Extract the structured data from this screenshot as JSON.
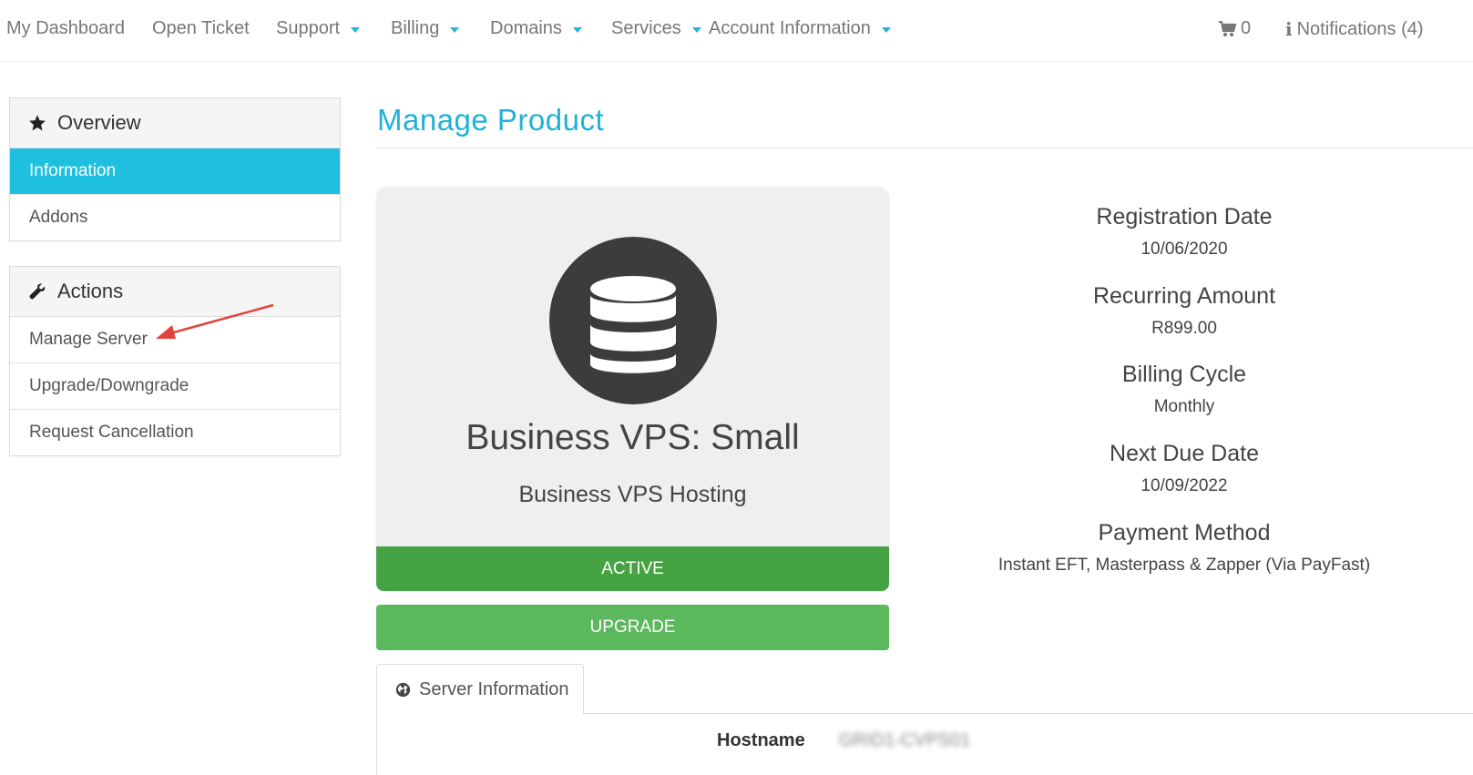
{
  "nav": {
    "items": [
      {
        "label": "My Dashboard",
        "dropdown": false
      },
      {
        "label": "Open Ticket",
        "dropdown": false
      },
      {
        "label": "Support",
        "dropdown": true
      },
      {
        "label": "Billing",
        "dropdown": true
      },
      {
        "label": "Domains",
        "dropdown": true
      },
      {
        "label": "Services",
        "dropdown": true
      },
      {
        "label": "Account Information",
        "dropdown": true
      }
    ],
    "cart_count": "0",
    "notifications": "Notifications (4)",
    "accent_color": "#1fb7de"
  },
  "sidebar": {
    "overview": {
      "title": "Overview",
      "icon": "star-icon",
      "items": [
        {
          "label": "Information",
          "active": true
        },
        {
          "label": "Addons",
          "active": false
        }
      ]
    },
    "actions": {
      "title": "Actions",
      "icon": "wrench-icon",
      "items": [
        {
          "label": "Manage Server"
        },
        {
          "label": "Upgrade/Downgrade"
        },
        {
          "label": "Request Cancellation"
        }
      ]
    },
    "active_color": "#1fbfe0"
  },
  "main": {
    "title": "Manage Product",
    "product": {
      "icon": "database-icon",
      "name": "Business VPS: Small",
      "group": "Business VPS Hosting",
      "status": "ACTIVE",
      "status_color": "#46a344",
      "upgrade_label": "UPGRADE",
      "upgrade_color": "#5cb85c"
    },
    "details": [
      {
        "label": "Registration Date",
        "value": "10/06/2020"
      },
      {
        "label": "Recurring Amount",
        "value": "R899.00"
      },
      {
        "label": "Billing Cycle",
        "value": "Monthly"
      },
      {
        "label": "Next Due Date",
        "value": "10/09/2022"
      },
      {
        "label": "Payment Method",
        "value": "Instant EFT, Masterpass & Zapper (Via PayFast)"
      }
    ],
    "tabs": [
      {
        "label": "Server Information",
        "icon": "globe-icon"
      }
    ],
    "server_info": {
      "hostname_label": "Hostname",
      "hostname_value": "GRID1-CVPS01"
    }
  },
  "annotation_color": "#e0443a"
}
